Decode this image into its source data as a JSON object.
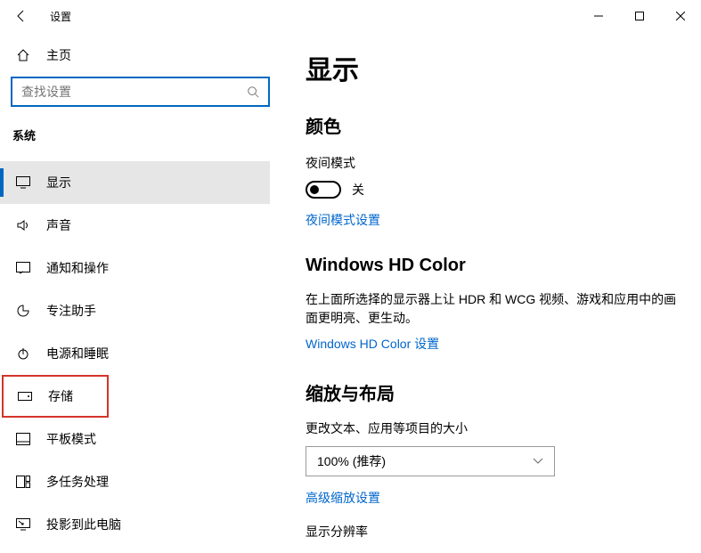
{
  "titlebar": {
    "title": "设置"
  },
  "sidebar": {
    "home": "主页",
    "search_placeholder": "查找设置",
    "group": "系统",
    "items": [
      {
        "label": "显示"
      },
      {
        "label": "声音"
      },
      {
        "label": "通知和操作"
      },
      {
        "label": "专注助手"
      },
      {
        "label": "电源和睡眠"
      },
      {
        "label": "存储"
      },
      {
        "label": "平板模式"
      },
      {
        "label": "多任务处理"
      },
      {
        "label": "投影到此电脑"
      }
    ]
  },
  "content": {
    "heading": "显示",
    "color_section": "颜色",
    "night_mode_label": "夜间模式",
    "night_mode_state": "关",
    "night_mode_link": "夜间模式设置",
    "hd_section": "Windows HD Color",
    "hd_desc": "在上面所选择的显示器上让 HDR 和 WCG 视频、游戏和应用中的画面更明亮、更生动。",
    "hd_link": "Windows HD Color 设置",
    "scale_section": "缩放与布局",
    "scale_label": "更改文本、应用等项目的大小",
    "scale_value": "100% (推荐)",
    "scale_link": "高级缩放设置",
    "resolution_label": "显示分辨率"
  }
}
